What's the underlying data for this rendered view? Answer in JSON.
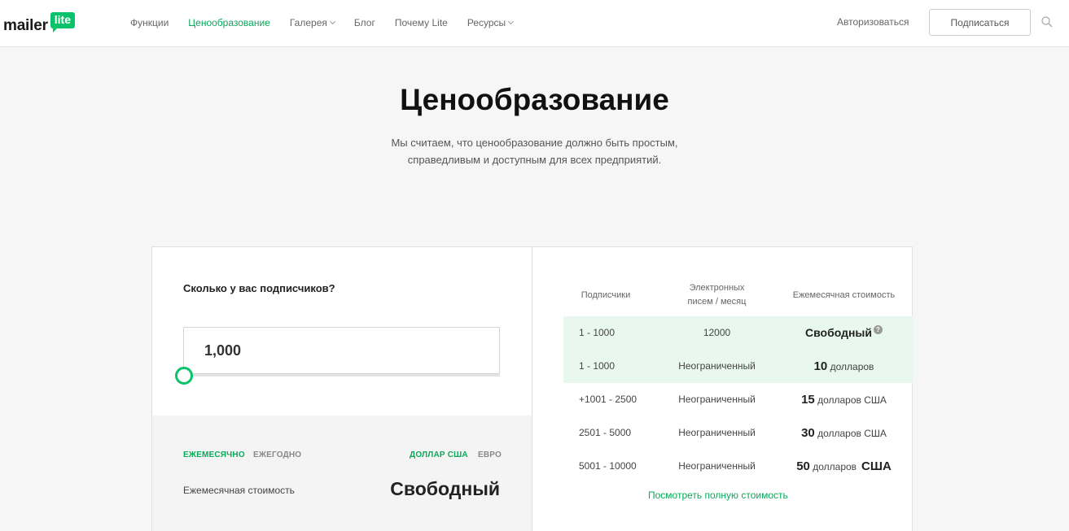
{
  "header": {
    "logo_main": "mailer",
    "logo_badge": "lite",
    "nav": [
      {
        "label": "Функции"
      },
      {
        "label": "Ценообразование"
      },
      {
        "label": "Галерея"
      },
      {
        "label": "Блог"
      },
      {
        "label": "Почему Lite"
      },
      {
        "label": "Ресурсы"
      }
    ],
    "login": "Авторизоваться",
    "signup": "Подписаться",
    "colors": {
      "accent": "#09c269",
      "active_link": "#09a85a"
    }
  },
  "hero": {
    "title": "Ценообразование",
    "subtitle_line1": "Мы считаем, что ценообразование должно быть простым,",
    "subtitle_line2": "справедливым и доступным для всех предприятий."
  },
  "calculator": {
    "question": "Сколько у вас подписчиков?",
    "subscribers_value": "1,000",
    "slider_level": 0,
    "billing": {
      "monthly": "ЕЖЕМЕСЯЧНО",
      "yearly": "ЕЖЕГОДНО",
      "selected": "monthly"
    },
    "currency": {
      "usd": "ДОЛЛАР США",
      "eur": "ЕВРО",
      "selected": "usd"
    },
    "monthly_cost_label": "Ежемесячная стоимость",
    "monthly_cost_value": "Свободный"
  },
  "pricing_table": {
    "headers": {
      "subscribers": "Подписчики",
      "emails_line1": "Электронных",
      "emails_line2": "писем / месяц",
      "monthly_cost": "Ежемесячная стоимость"
    },
    "rows": [
      {
        "range": "1 - 1000",
        "emails": "12000",
        "price_num": "",
        "price_text": "Свободный",
        "suffix": "",
        "highlight": true
      },
      {
        "range": "1 - 1000",
        "emails": "Неограниченный",
        "price_num": "10",
        "price_text": "долларов",
        "suffix": "",
        "highlight": true
      },
      {
        "range": "+1001 - 2500",
        "emails": "Неограниченный",
        "price_num": "15",
        "price_text": "долларов США",
        "suffix": "",
        "highlight": false
      },
      {
        "range": "2501 - 5000",
        "emails": "Неограниченный",
        "price_num": "30",
        "price_text": "долларов США",
        "suffix": "",
        "highlight": false
      },
      {
        "range": "5001 - 10000",
        "emails": "Неограниченный",
        "price_num": "50",
        "price_text": "долларов",
        "suffix": "США",
        "highlight": false
      }
    ],
    "help_mark": "?",
    "full_pricing_link": "Посмотреть полную стоимость"
  }
}
